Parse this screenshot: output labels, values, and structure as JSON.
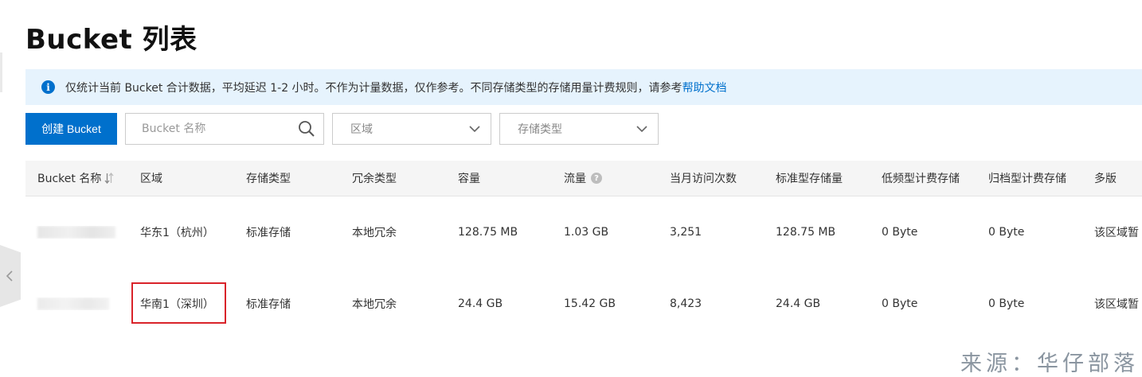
{
  "page_title": "Bucket 列表",
  "notice": {
    "text": "仅统计当前 Bucket 合计数据，平均延迟 1-2 小时。不作为计量数据，仅作参考。不同存储类型的存储用量计费规则，请参考",
    "link": "帮助文档"
  },
  "toolbar": {
    "create_label": "创建 Bucket",
    "search_placeholder": "Bucket 名称",
    "region_select": "区域",
    "storage_select": "存储类型"
  },
  "table": {
    "columns": [
      "Bucket 名称",
      "区域",
      "存储类型",
      "冗余类型",
      "容量",
      "流量",
      "当月访问次数",
      "标准型存储量",
      "低频型计费存储",
      "归档型计费存储",
      "多版"
    ],
    "rows": [
      {
        "region": "华东1（杭州）",
        "storage_type": "标准存储",
        "redundancy": "本地冗余",
        "capacity": "128.75 MB",
        "traffic": "1.03 GB",
        "visits": "3,251",
        "standard": "128.75 MB",
        "ia": "0 Byte",
        "archive": "0 Byte",
        "versioning": "该区域暂"
      },
      {
        "region": "华南1（深圳）",
        "storage_type": "标准存储",
        "redundancy": "本地冗余",
        "capacity": "24.4 GB",
        "traffic": "15.42 GB",
        "visits": "8,423",
        "standard": "24.4 GB",
        "ia": "0 Byte",
        "archive": "0 Byte",
        "versioning": "该区域暂"
      }
    ]
  },
  "watermark": "来源：华仔部落",
  "colors": {
    "primary": "#0070cc",
    "notice_bg": "#e6f3fd",
    "header_bg": "#f5f5f5",
    "highlight": "#d9232a"
  },
  "icons": {
    "notice": "info-icon",
    "search": "search-icon",
    "select": "chevron-down-icon",
    "sort": "sort-icon",
    "help": "help-icon",
    "collapse": "chevron-left-icon"
  }
}
